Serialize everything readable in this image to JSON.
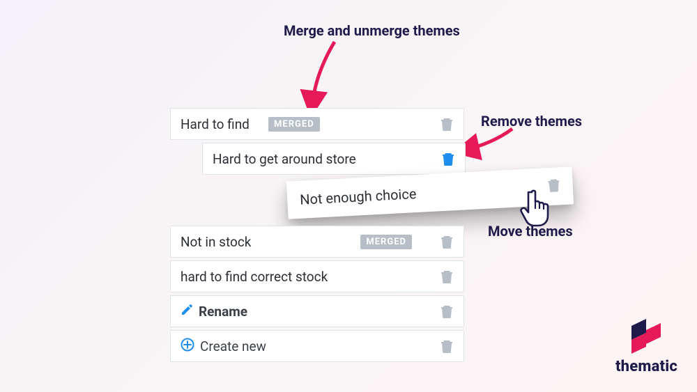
{
  "annotations": {
    "merge": "Merge and unmerge themes",
    "remove": "Remove themes",
    "move": "Move themes"
  },
  "badge": "MERGED",
  "rows": {
    "r1": "Hard to find",
    "r2": "Hard to get around store",
    "floating": "Not enough choice",
    "r4": "Not in stock",
    "r5": "hard to find correct stock",
    "rename": "Rename",
    "create": "Create new"
  },
  "logo_text": "thematic",
  "colors": {
    "accent": "#e61a59",
    "blue": "#1e8ef0",
    "navy": "#1e1a4a"
  }
}
